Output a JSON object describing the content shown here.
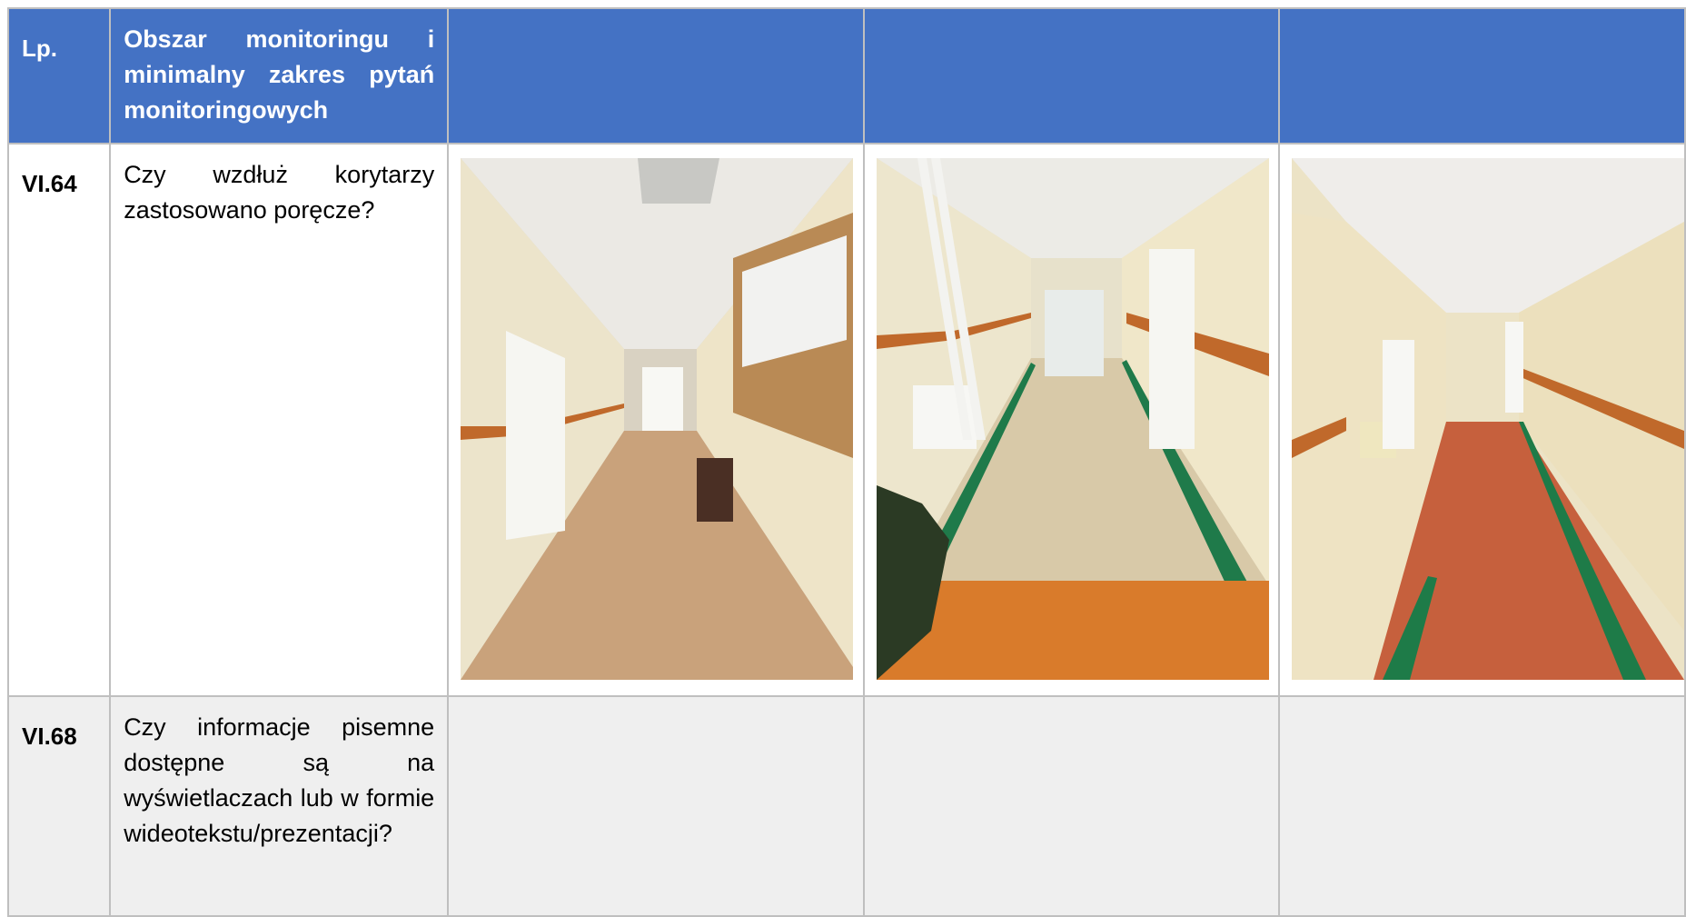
{
  "header": {
    "lp": "Lp.",
    "area": "Obszar monitoringu i minimalny zakres pytań monitoringowych"
  },
  "rows": [
    {
      "lp": "VI.64",
      "question": "Czy wzdłuż korytarzy zastosowano poręcze?"
    },
    {
      "lp": "VI.68",
      "question": "Czy informacje pisemne dostępne są na wyświetlaczach lub w formie wideotekstu/prezentacji?"
    }
  ],
  "photos": [
    {
      "subject": "corridor-tiled-floor-with-noticeboard"
    },
    {
      "subject": "corridor-beige-floor-green-edges"
    },
    {
      "subject": "corridor-red-floor-green-edges"
    }
  ],
  "colors": {
    "header_bg": "#4472c4",
    "border": "#bfbfbf",
    "row_alt_bg": "#efefef"
  }
}
